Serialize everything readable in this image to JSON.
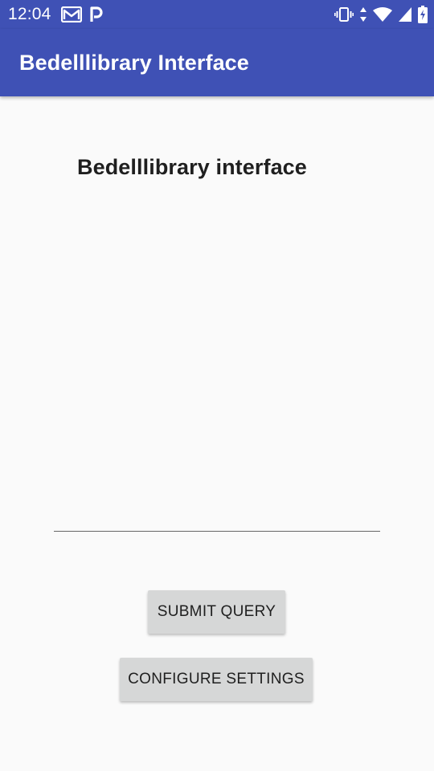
{
  "status_bar": {
    "time": "12:04",
    "left_icons": [
      "gmail-icon",
      "parking-p-icon"
    ],
    "right_icons": [
      "vibrate-icon",
      "data-arrows-icon",
      "wifi-icon",
      "cell-signal-icon",
      "battery-charging-icon"
    ]
  },
  "app_bar": {
    "title": "Bedelllibrary Interface"
  },
  "main": {
    "heading": "Bedelllibrary interface",
    "query_input": {
      "value": "",
      "placeholder": ""
    },
    "submit_button": "SUBMIT QUERY",
    "configure_button": "CONFIGURE SETTINGS"
  },
  "colors": {
    "primary": "#3f51b5",
    "background": "#fafafa",
    "button": "#d6d7d7"
  }
}
